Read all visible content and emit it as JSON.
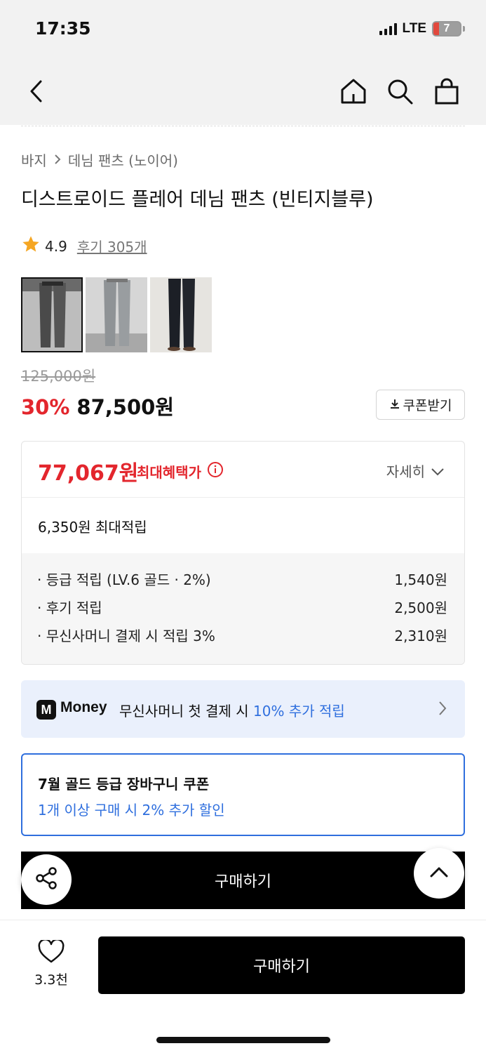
{
  "status": {
    "time": "17:35",
    "network": "LTE",
    "battery": "7"
  },
  "breadcrumb": {
    "category": "바지",
    "subcategory": "데님 팬츠 (노이어)"
  },
  "product": {
    "title": "디스트로이드 플레어 데님 팬츠 (빈티지블루)",
    "rating": "4.9",
    "reviews": "후기 305개",
    "original_price": "125,000원",
    "discount": "30%",
    "sale_price": "87,500원",
    "coupon_button": "쿠폰받기"
  },
  "benefit": {
    "max_price": "77,067원",
    "max_price_label": "최대혜택가",
    "detail_toggle": "자세히",
    "max_points": "6,350원 최대적립",
    "points": [
      {
        "label": "· 등급 적립 (LV.6 골드 · 2%)",
        "value": "1,540원"
      },
      {
        "label": "· 후기 적립",
        "value": "2,500원"
      },
      {
        "label": "· 무신사머니 결제 시 적립 3%",
        "value": "2,310원"
      }
    ]
  },
  "money_banner": {
    "logo": "M",
    "brand": "Money",
    "text": "무신사머니 첫 결제 시 ",
    "highlight": "10% 추가 적립"
  },
  "grade_coupon": {
    "title": "7월 골드 등급 장바구니 쿠폰",
    "subtitle": "1개 이상 구매 시 2% 추가 할인"
  },
  "inline_buy": "구매하기",
  "bottom_bar": {
    "like_count": "3.3천",
    "buy_label": "구매하기"
  },
  "colors": {
    "accent_red": "#e3262d",
    "accent_blue": "#2f6fde",
    "banner_bg": "#eaf0fc"
  }
}
